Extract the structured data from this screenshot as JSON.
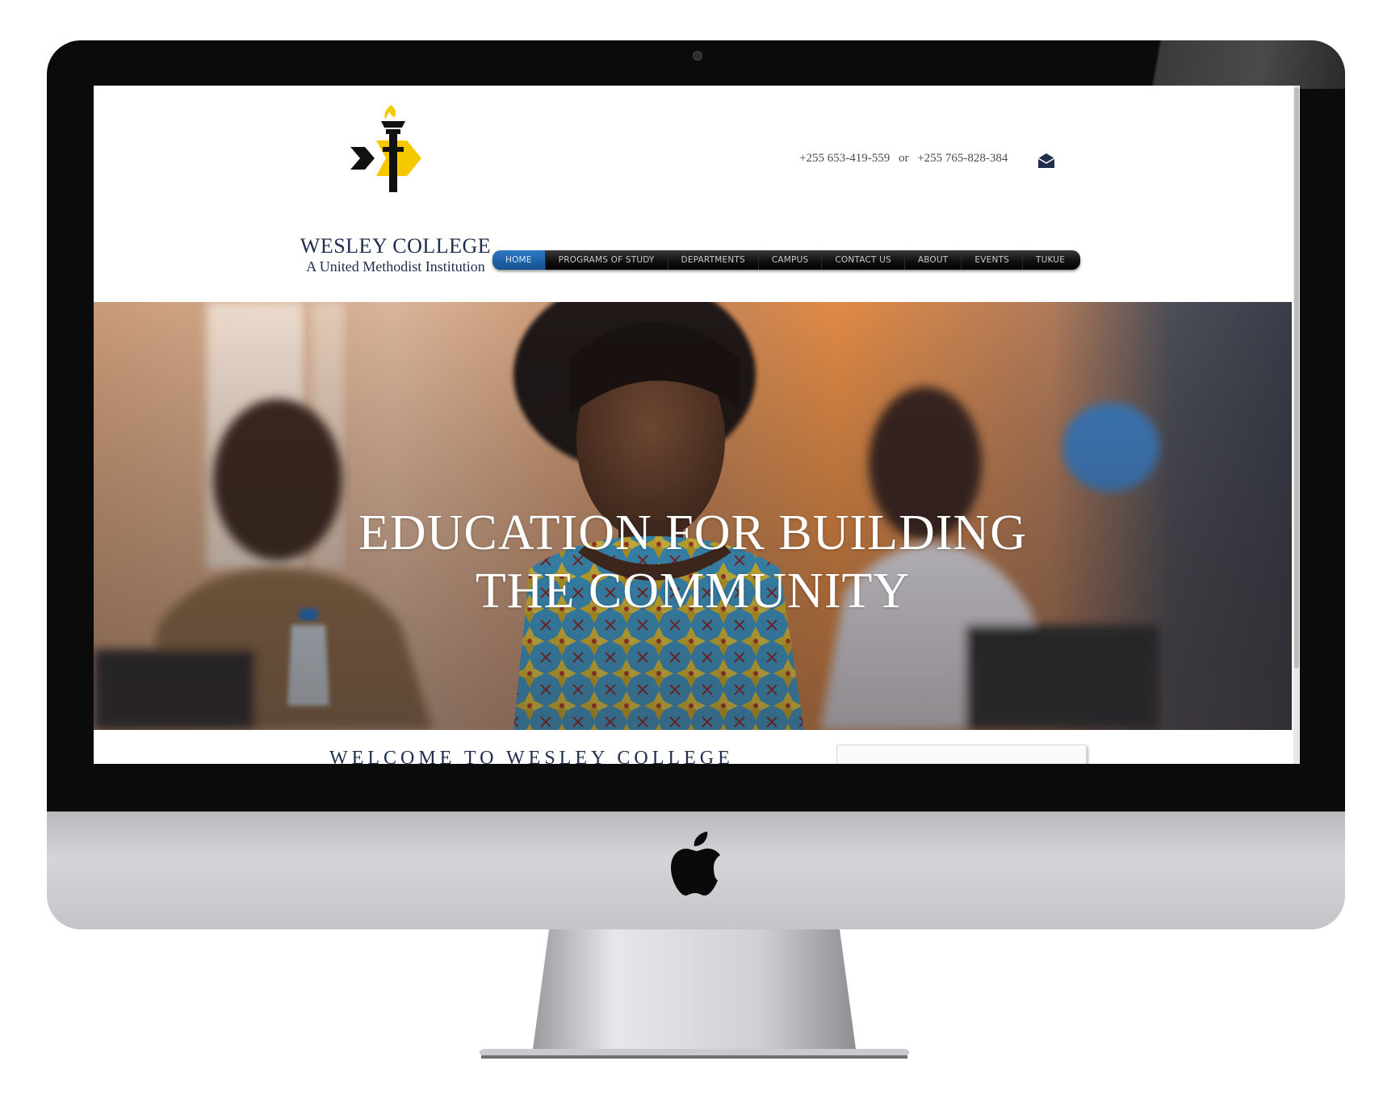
{
  "site": {
    "name": "WESLEY COLLEGE",
    "tagline": "A United Methodist Institution",
    "contact": {
      "phone_primary": "+255 653-419-559",
      "separator": "or",
      "phone_secondary": "+255 765-828-384",
      "icon": "envelope-icon"
    }
  },
  "nav": {
    "items": [
      {
        "label": "HOME",
        "active": true
      },
      {
        "label": "PROGRAMS OF STUDY"
      },
      {
        "label": "DEPARTMENTS"
      },
      {
        "label": "CAMPUS"
      },
      {
        "label": "CONTACT US"
      },
      {
        "label": "ABOUT"
      },
      {
        "label": "EVENTS"
      },
      {
        "label": "TUKUE"
      }
    ]
  },
  "hero": {
    "title_line1": "EDUCATION FOR BUILDING",
    "title_line2": "THE COMMUNITY"
  },
  "welcome": {
    "heading": "WELCOME TO WESLEY COLLEGE"
  },
  "colors": {
    "brand_navy": "#1f2d4e",
    "logo_yellow": "#f5c800",
    "nav_active": "#1f63ab",
    "nav_bg": "#000000"
  }
}
